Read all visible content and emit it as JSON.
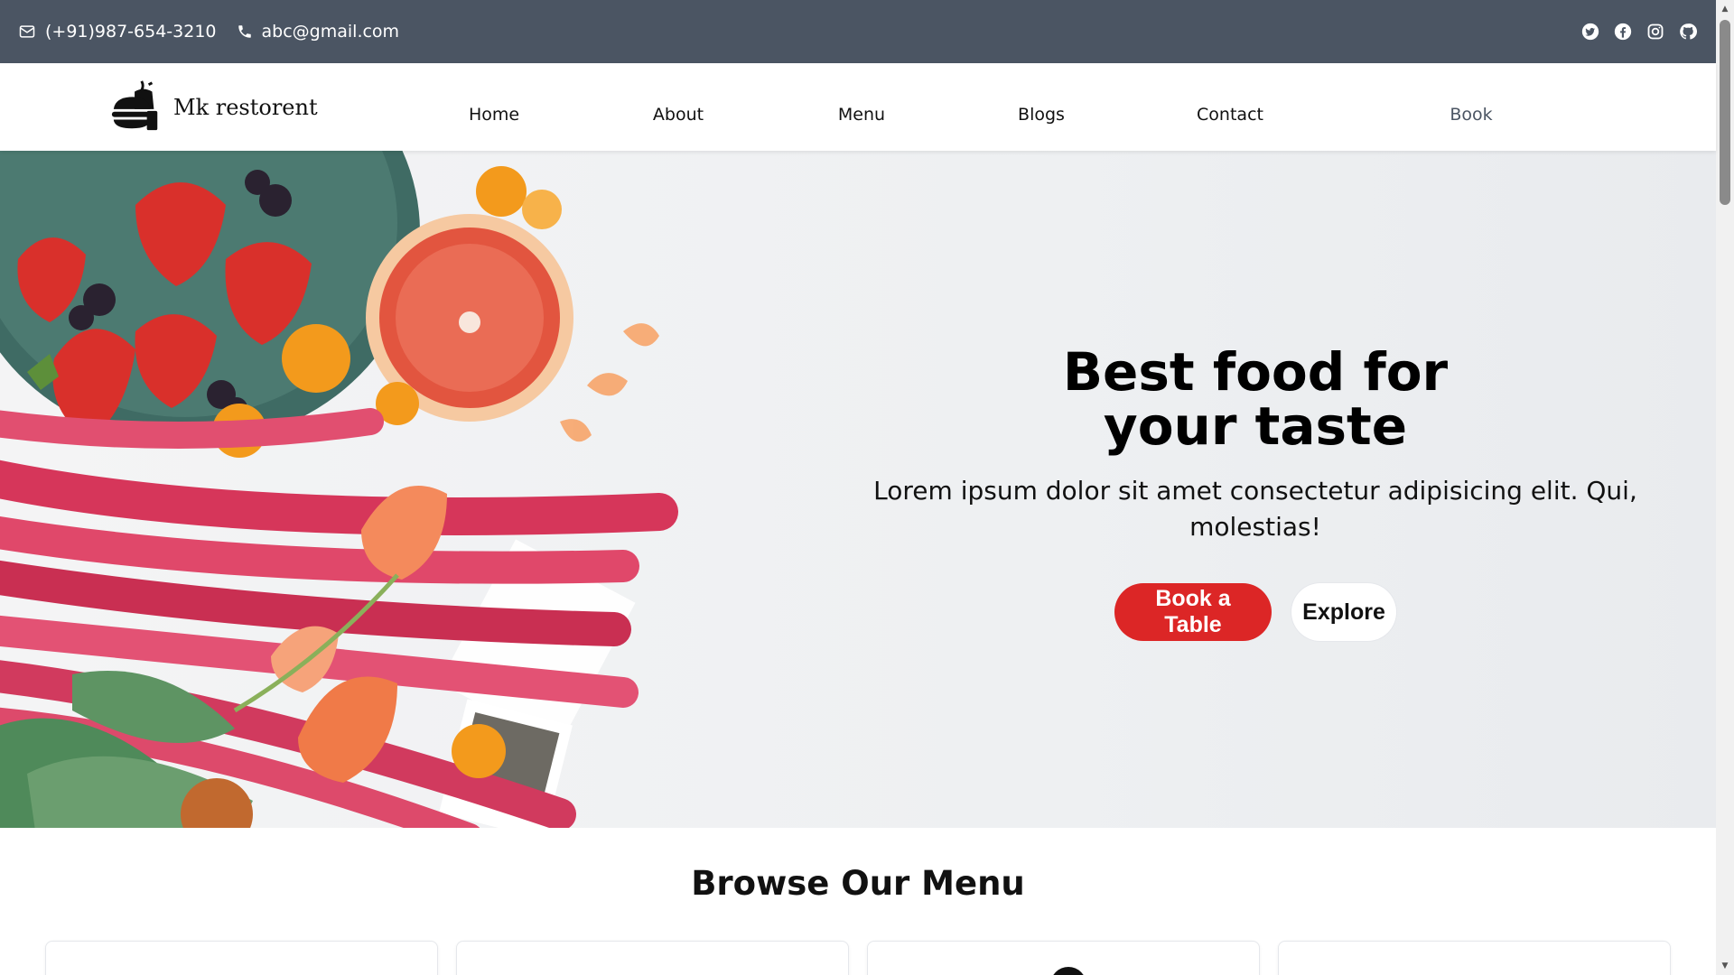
{
  "topbar": {
    "phone": "(+91)987-654-3210",
    "email": "abc@gmail.com",
    "icons": [
      "mail-icon",
      "phone-icon"
    ],
    "socials": [
      "twitter-icon",
      "facebook-icon",
      "instagram-icon",
      "github-icon"
    ],
    "background": "#4b5563"
  },
  "navbar": {
    "brand": "Mk restorent",
    "items": [
      "Home",
      "About",
      "Menu",
      "Blogs",
      "Contact",
      "Book"
    ]
  },
  "hero": {
    "title_line1": "Best food for",
    "title_line2": "your taste",
    "subtitle": "Lorem ipsum dolor sit amet consectetur adipisicing elit. Qui, molestias!",
    "primary_button": "Book a Table",
    "secondary_button": "Explore",
    "accent": "#dc2626"
  },
  "menu_section": {
    "title": "Browse Our Menu"
  }
}
